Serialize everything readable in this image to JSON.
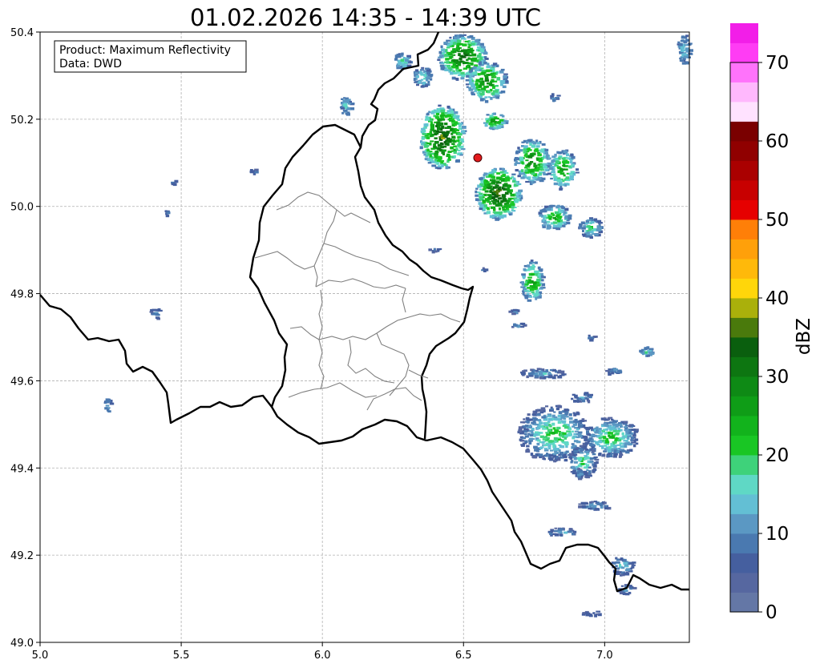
{
  "title": "01.02.2026 14:35 - 14:39 UTC",
  "info_box": {
    "line1": "Product: Maximum Reflectivity",
    "line2": "Data: DWD"
  },
  "axes": {
    "x_ticks": [
      "5.0",
      "5.5",
      "6.0",
      "6.5",
      "7.0"
    ],
    "y_ticks": [
      "49.0",
      "49.2",
      "49.4",
      "49.6",
      "49.8",
      "50.0",
      "50.2",
      "50.4"
    ],
    "xlim": [
      5.0,
      7.3
    ],
    "ylim": [
      49.0,
      50.4
    ],
    "grid": "dashed-gray"
  },
  "colorbar": {
    "label": "dBZ",
    "tick_labels": [
      "0",
      "10",
      "20",
      "30",
      "40",
      "50",
      "60",
      "70"
    ],
    "range": [
      0,
      70
    ],
    "step": 2.5,
    "colors": [
      "#6477a6",
      "#5667a0",
      "#455f9f",
      "#4a79b0",
      "#5b98c3",
      "#63bfd4",
      "#5fd8c5",
      "#3ed27a",
      "#19c624",
      "#12b31c",
      "#0f9d17",
      "#0e8a15",
      "#0d7611",
      "#0a5f0e",
      "#4a7a0c",
      "#aab00b",
      "#ffd60a",
      "#ffb90a",
      "#ffa00a",
      "#ff7f08",
      "#e60000",
      "#c80000",
      "#aa0000",
      "#900000",
      "#7a0000",
      "#ffe2ff",
      "#ffb8fd",
      "#ff73fb",
      "#ff3cf4",
      "#f21ee8"
    ]
  },
  "radar_marker": {
    "lon": 6.54,
    "lat": 50.11,
    "color": "#e31a1c"
  }
}
